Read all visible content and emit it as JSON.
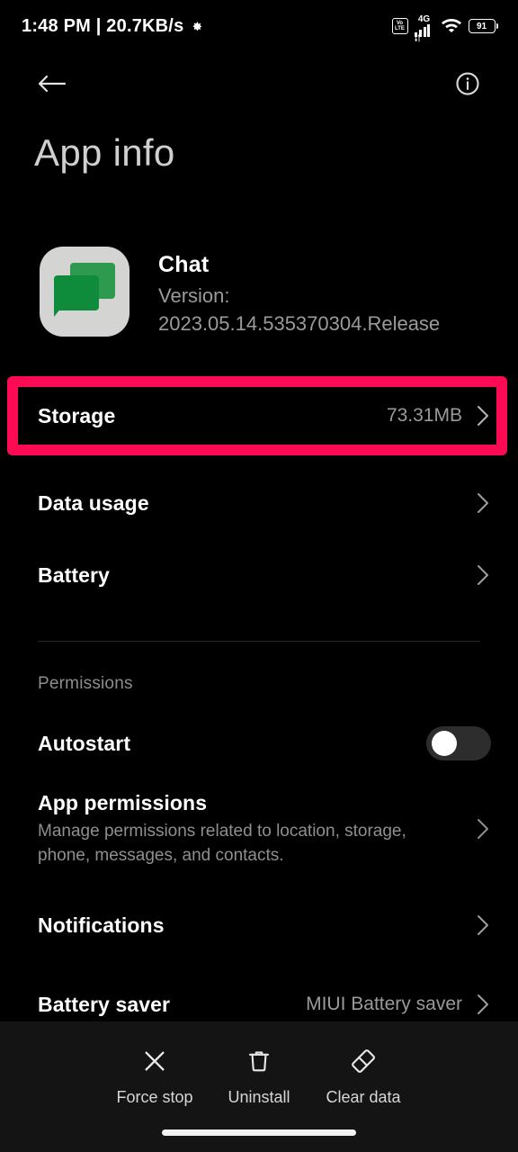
{
  "statusbar": {
    "clock": "1:48 PM | 20.7KB/s",
    "settings_icon": "gear-icon",
    "volte_top": "Vo",
    "volte_bottom": "LTE",
    "network_type": "4G",
    "wifi_icon": "wifi-icon",
    "battery_percent": "91"
  },
  "topnav": {
    "back_icon": "back-arrow-icon",
    "info_icon": "info-circle-icon"
  },
  "page": {
    "title": "App info"
  },
  "app": {
    "icon": "chat-app-icon",
    "name": "Chat",
    "version_label": "Version:",
    "version_value": "2023.05.14.535370304.Release",
    "version_full": "Version: 2023.05.14.535370304.Release"
  },
  "highlight": {
    "color": "#fc0a54",
    "target": "Storage"
  },
  "rows": {
    "storage": {
      "title": "Storage",
      "value": "73.31MB",
      "chevron": "chevron-right-icon"
    },
    "data_usage": {
      "title": "Data usage",
      "value": "",
      "chevron": "chevron-right-icon"
    },
    "battery": {
      "title": "Battery",
      "value": "",
      "chevron": "chevron-right-icon"
    },
    "autostart": {
      "title": "Autostart",
      "toggle_state": "off"
    },
    "app_permissions": {
      "title": "App permissions",
      "subtitle": "Manage permissions related to location, storage, phone, messages, and contacts.",
      "chevron": "chevron-right-icon"
    },
    "notifications": {
      "title": "Notifications",
      "value": "",
      "chevron": "chevron-right-icon"
    },
    "battery_saver": {
      "title": "Battery saver",
      "value": "MIUI Battery saver",
      "chevron": "chevron-right-icon"
    }
  },
  "sections": {
    "permissions_label": "Permissions"
  },
  "bottombar": {
    "actions": [
      {
        "label": "Force stop",
        "icon": "close-x-icon"
      },
      {
        "label": "Uninstall",
        "icon": "trash-icon"
      },
      {
        "label": "Clear data",
        "icon": "eraser-icon"
      }
    ]
  }
}
